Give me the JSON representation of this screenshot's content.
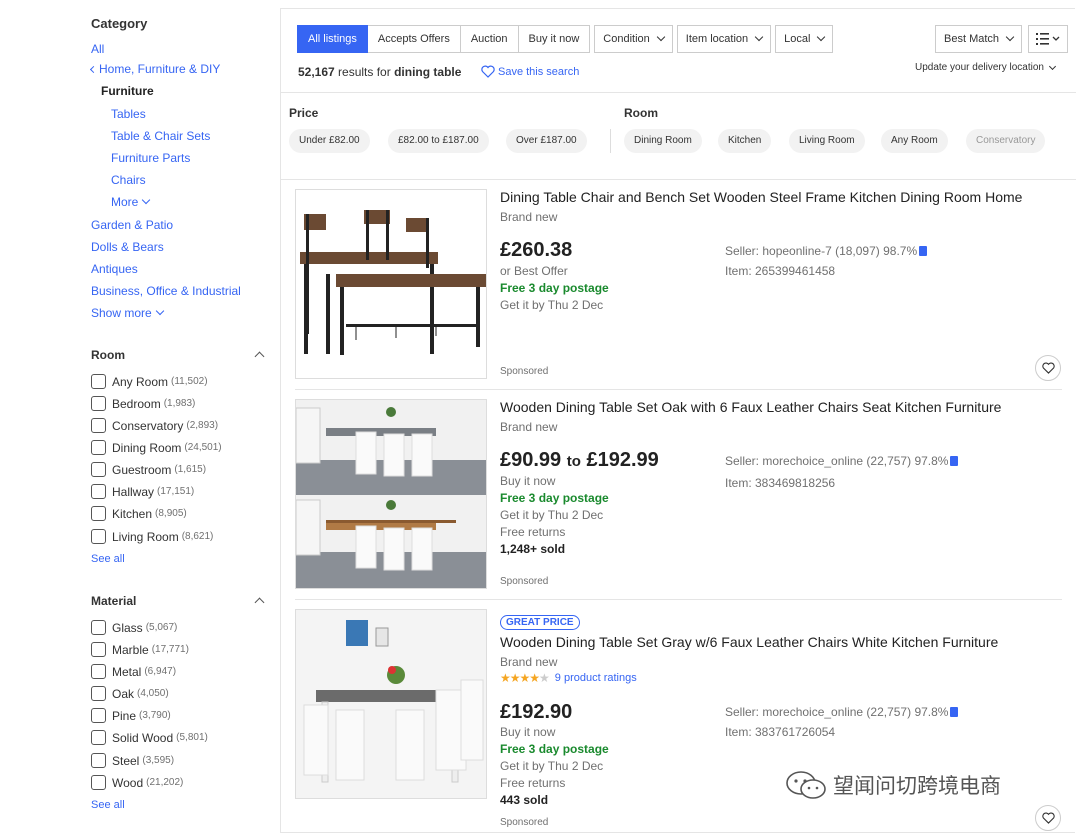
{
  "sidebar": {
    "category_title": "Category",
    "all": "All",
    "parent": "Home, Furniture & DIY",
    "current": "Furniture",
    "subcats": [
      "Tables",
      "Table & Chair Sets",
      "Furniture Parts",
      "Chairs"
    ],
    "more": "More",
    "siblings": [
      "Garden & Patio",
      "Dolls & Bears",
      "Antiques",
      "Business, Office & Industrial"
    ],
    "show_more": "Show more",
    "room": {
      "title": "Room",
      "options": [
        {
          "label": "Any Room",
          "count": "(11,502)"
        },
        {
          "label": "Bedroom",
          "count": "(1,983)"
        },
        {
          "label": "Conservatory",
          "count": "(2,893)"
        },
        {
          "label": "Dining Room",
          "count": "(24,501)"
        },
        {
          "label": "Guestroom",
          "count": "(1,615)"
        },
        {
          "label": "Hallway",
          "count": "(17,151)"
        },
        {
          "label": "Kitchen",
          "count": "(8,905)"
        },
        {
          "label": "Living Room",
          "count": "(8,621)"
        }
      ],
      "see_all": "See all"
    },
    "material": {
      "title": "Material",
      "options": [
        {
          "label": "Glass",
          "count": "(5,067)"
        },
        {
          "label": "Marble",
          "count": "(17,771)"
        },
        {
          "label": "Metal",
          "count": "(6,947)"
        },
        {
          "label": "Oak",
          "count": "(4,050)"
        },
        {
          "label": "Pine",
          "count": "(3,790)"
        },
        {
          "label": "Solid Wood",
          "count": "(5,801)"
        },
        {
          "label": "Steel",
          "count": "(3,595)"
        },
        {
          "label": "Wood",
          "count": "(21,202)"
        }
      ],
      "see_all": "See all"
    }
  },
  "toolbar": {
    "tabs": [
      "All listings",
      "Accepts Offers",
      "Auction",
      "Buy it now"
    ],
    "dropdowns": [
      "Condition",
      "Item location",
      "Local"
    ],
    "sort": "Best Match",
    "results_count": "52,167",
    "results_text": "results for",
    "query": "dining table",
    "save_search": "Save this search",
    "delivery": "Update your delivery location"
  },
  "refine": {
    "price_title": "Price",
    "price_pills": [
      "Under £82.00",
      "£82.00 to £187.00",
      "Over £187.00"
    ],
    "room_title": "Room",
    "room_pills": [
      "Dining Room",
      "Kitchen",
      "Living Room",
      "Any Room",
      "Conservatory"
    ]
  },
  "listings": [
    {
      "title": "Dining Table Chair and Bench Set Wooden Steel Frame Kitchen Dining Room Home",
      "condition": "Brand new",
      "price": "£260.38",
      "format": "or Best Offer",
      "postage": "Free 3 day postage",
      "delivery": "Get it by Thu 2 Dec",
      "seller": "Seller: hopeonline-7 (18,097) 98.7%",
      "item_no": "Item: 265399461458",
      "sponsored": "Sponsored"
    },
    {
      "title": "Wooden Dining Table Set Oak with 6 Faux Leather Chairs Seat Kitchen Furniture",
      "condition": "Brand new",
      "price_low": "£90.99",
      "price_to": "to",
      "price_high": "£192.99",
      "format": "Buy it now",
      "postage": "Free 3 day postage",
      "delivery": "Get it by Thu 2 Dec",
      "returns": "Free returns",
      "sold": "1,248+ sold",
      "seller": "Seller: morechoice_online (22,757) 97.8%",
      "item_no": "Item: 383469818256",
      "sponsored": "Sponsored"
    },
    {
      "badge": "GREAT PRICE",
      "title": "Wooden Dining Table Set Gray w/6 Faux Leather Chairs White Kitchen Furniture",
      "condition": "Brand new",
      "rating_stars": 4.5,
      "ratings": "9 product ratings",
      "price": "£192.90",
      "format": "Buy it now",
      "postage": "Free 3 day postage",
      "delivery": "Get it by Thu 2 Dec",
      "returns": "Free returns",
      "sold": "443 sold",
      "seller": "Seller: morechoice_online (22,757) 97.8%",
      "item_no": "Item: 383761726054",
      "sponsored": "Sponsored"
    }
  ],
  "watermark": "望闻问切跨境电商",
  "colors": {
    "accent": "#3665f3",
    "green": "#1a8a2e",
    "star": "#f5a623"
  }
}
